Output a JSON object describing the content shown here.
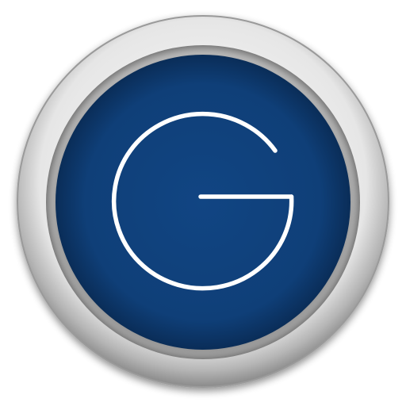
{
  "icon": {
    "name": "letter-g-app-icon",
    "glyph": "G",
    "colors": {
      "background": "#ffffff",
      "bezel_light": "#f4f4f4",
      "bezel_mid": "#c8c8c8",
      "bezel_dark": "#8f8f8f",
      "face": "#0f4079",
      "face_dark": "#0a2f5c",
      "stroke": "#ffffff"
    }
  }
}
